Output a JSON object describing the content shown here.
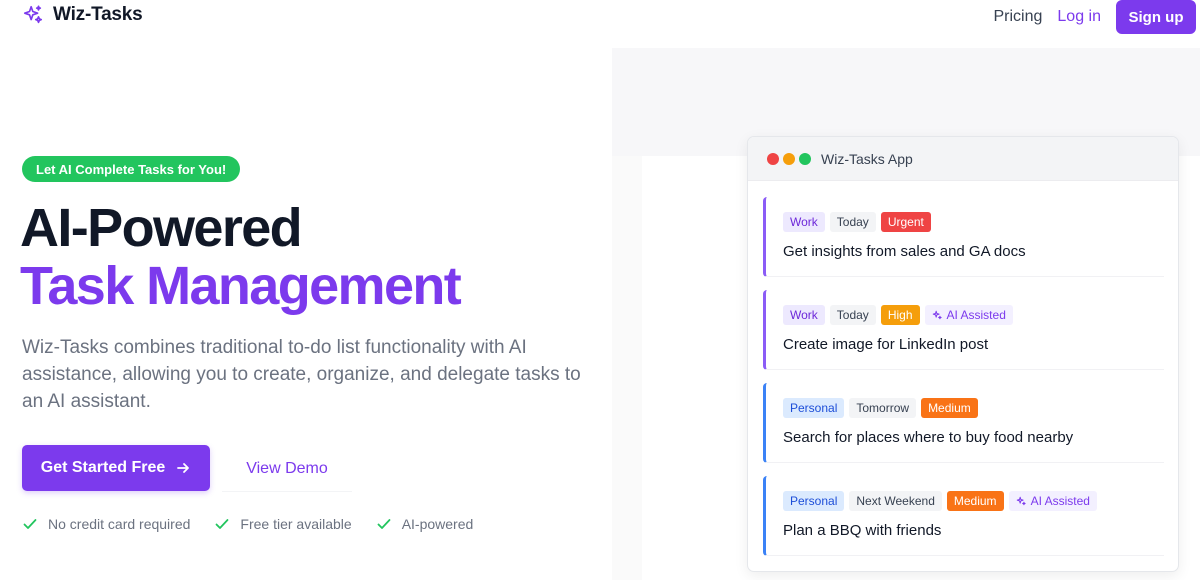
{
  "header": {
    "brand_name": "Wiz-Tasks",
    "brand_icon": "sparkles-icon",
    "nav": {
      "pricing": "Pricing",
      "login": "Log in",
      "signup": "Sign up"
    }
  },
  "hero": {
    "badge": "Let AI Complete Tasks for You!",
    "title_line1": "AI-Powered",
    "title_line2": "Task Management",
    "description": "Wiz-Tasks combines traditional to-do list functionality with AI assistance, allowing you to create, organize, and delegate tasks to an AI assistant.",
    "cta_primary": "Get Started Free",
    "cta_secondary": "View Demo",
    "checks": [
      "No credit card required",
      "Free tier available",
      "AI-powered"
    ]
  },
  "app": {
    "title": "Wiz-Tasks App",
    "tasks": [
      {
        "category": "Work",
        "date": "Today",
        "priority": "Urgent",
        "ai": "",
        "text": "Get insights from sales and GA docs"
      },
      {
        "category": "Work",
        "date": "Today",
        "priority": "High",
        "ai": "AI Assisted",
        "text": "Create image for LinkedIn post"
      },
      {
        "category": "Personal",
        "date": "Tomorrow",
        "priority": "Medium",
        "ai": "",
        "text": "Search for places where to buy food nearby"
      },
      {
        "category": "Personal",
        "date": "Next Weekend",
        "priority": "Medium",
        "ai": "AI Assisted",
        "text": "Plan a BBQ with friends"
      }
    ]
  },
  "colors": {
    "accent": "#7c3aed",
    "badge_green": "#22c55e",
    "urgent": "#ef4444",
    "high": "#f59e0b",
    "medium": "#f97316",
    "work_border": "#8b5cf6",
    "personal_border": "#3b82f6"
  }
}
